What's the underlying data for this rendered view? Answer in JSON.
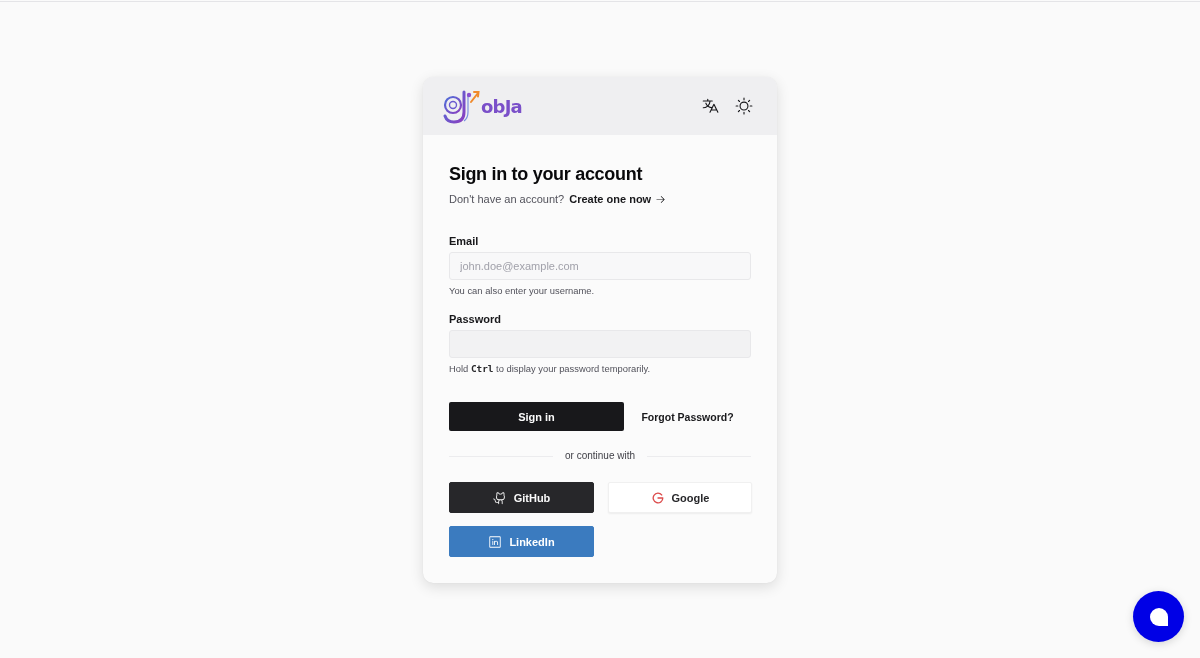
{
  "header": {
    "logo_text": "obJa"
  },
  "title": "Sign in to your account",
  "signup_prompt": {
    "text": "Don't have an account?",
    "link": "Create one now"
  },
  "fields": [
    {
      "kind": "email",
      "label": "Email",
      "placeholder": "john.doe@example.com",
      "hint": "You can also enter your username."
    },
    {
      "kind": "password",
      "label": "Password",
      "hint": "Hold **Ctrl** to display your password temporarily."
    }
  ],
  "sign_in_button": "Sign in",
  "forgot_password_link": "Forgot Password?",
  "divider": "or continue with",
  "social_buttons": [
    {
      "kind": "github",
      "label": "GitHub"
    },
    {
      "kind": "google",
      "label": "Google"
    },
    {
      "kind": "linkedin",
      "label": "LinkedIn"
    }
  ]
}
